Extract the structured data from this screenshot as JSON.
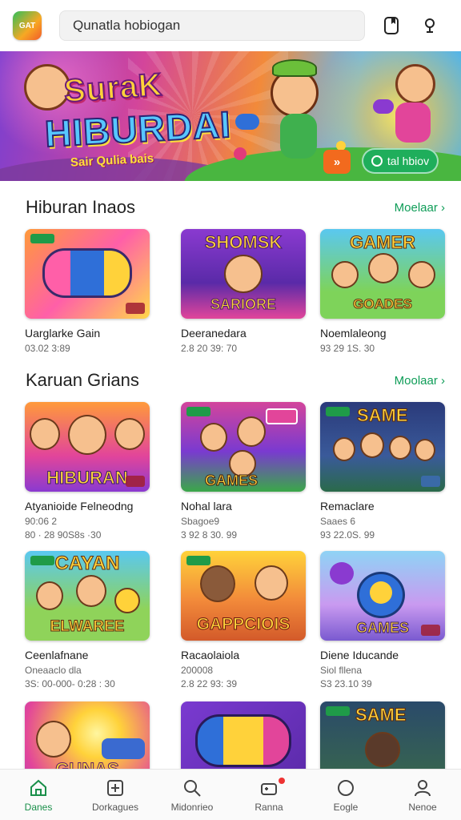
{
  "header": {
    "logo_text": "GAT",
    "search_value": "Qunatla hobiogan",
    "icons": [
      "bookmark-icon",
      "profile-icon"
    ]
  },
  "banner": {
    "title_line1": "SuraK",
    "title_line2": "HIBURDAI",
    "subtitle": "Sair Qulia bais",
    "arrow_label": "»",
    "button_label": "tal hbiov"
  },
  "sections": [
    {
      "title": "Hiburan Inaos",
      "more": "Moelaar ›",
      "cards": [
        {
          "title": "Uarglarke Gain",
          "sub": "03.02 3:89",
          "art": "GAME PAD"
        },
        {
          "title": "Deeranedara",
          "sub": "2.8 20 39: 70",
          "art": "SHOMSK / SARIORE"
        },
        {
          "title": "Noemlaleong",
          "sub": "93 29 1S. 30",
          "art": "GAMER / GOADES"
        }
      ]
    },
    {
      "title": "Karuan Grians",
      "more": "Moolaar ›",
      "cards": [
        {
          "title": "Atyanioide Felneodng",
          "sub": "90:06 2",
          "sub2": "80 · 28 90S8s ·30",
          "art": "HIBURAN"
        },
        {
          "title": "Nohal lara",
          "sub": "Sbagoe9",
          "sub2": "3 92 8 30. 99",
          "art": "GAMES"
        },
        {
          "title": "Remaclare",
          "sub": "Saaes 6",
          "sub2": "93 22.0S. 99",
          "art": "SAME"
        },
        {
          "title": "Ceenlafnane",
          "sub": "Oneaaclo dla",
          "sub2": "3S: 00-000- 0:28 : 30",
          "art": "CAYAN / ELWAREE"
        },
        {
          "title": "Racaolaiola",
          "sub": "200008",
          "sub2": "2.8 22 93: 39",
          "art": "GAPPCIOIS"
        },
        {
          "title": "Diene Iducande",
          "sub": "Siol fllena",
          "sub2": "S3 23.10 39",
          "art": "GAMES"
        }
      ]
    }
  ],
  "bottom_row": [
    {
      "art": "GUNAS"
    },
    {
      "art": ""
    },
    {
      "art": "SAME"
    }
  ],
  "nav": [
    {
      "label": "Danes",
      "icon": "home-icon",
      "active": true
    },
    {
      "label": "Dorkagues",
      "icon": "plus-square-icon",
      "active": false
    },
    {
      "label": "Midonrieo",
      "icon": "search-icon",
      "active": false
    },
    {
      "label": "Ranna",
      "icon": "gamepad-icon",
      "active": false
    },
    {
      "label": "Eogle",
      "icon": "circle-icon",
      "active": false
    },
    {
      "label": "Nenoe",
      "icon": "person-icon",
      "active": false
    }
  ],
  "colors": {
    "accent": "#0f9d58",
    "nav_active": "#1a8f4a",
    "banner_button": "#1fae5b",
    "banner_arrow": "#f26a1e"
  }
}
